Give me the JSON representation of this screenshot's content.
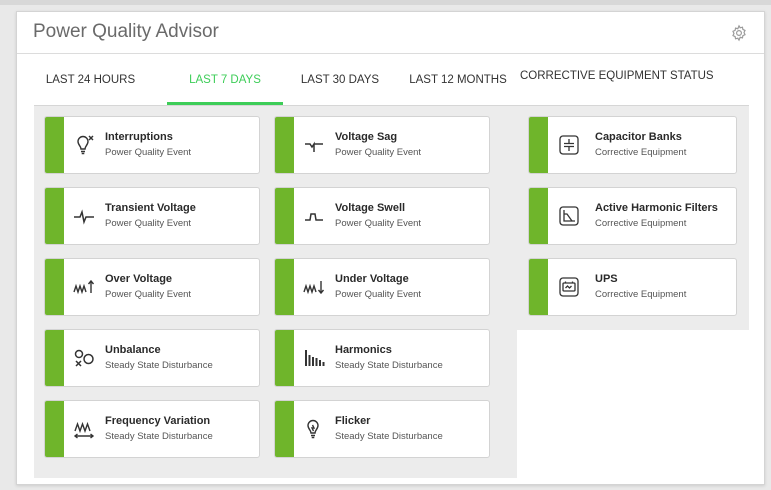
{
  "widget": {
    "title": "Power Quality Advisor"
  },
  "tabs": [
    {
      "label": "LAST 24 HOURS",
      "active": false
    },
    {
      "label": "LAST 7 DAYS",
      "active": true
    },
    {
      "label": "LAST 30 DAYS",
      "active": false
    },
    {
      "label": "LAST 12 MONTHS",
      "active": false
    }
  ],
  "events": [
    {
      "title": "Interruptions",
      "subtitle": "Power Quality Event",
      "icon": "interruption-bulb-icon"
    },
    {
      "title": "Voltage Sag",
      "subtitle": "Power Quality Event",
      "icon": "voltage-sag-icon"
    },
    {
      "title": "Transient Voltage",
      "subtitle": "Power Quality Event",
      "icon": "transient-voltage-icon"
    },
    {
      "title": "Voltage Swell",
      "subtitle": "Power Quality Event",
      "icon": "voltage-swell-icon"
    },
    {
      "title": "Over Voltage",
      "subtitle": "Power Quality Event",
      "icon": "over-voltage-icon"
    },
    {
      "title": "Under Voltage",
      "subtitle": "Power Quality Event",
      "icon": "under-voltage-icon"
    },
    {
      "title": "Unbalance",
      "subtitle": "Steady State Disturbance",
      "icon": "unbalance-icon"
    },
    {
      "title": "Harmonics",
      "subtitle": "Steady State Disturbance",
      "icon": "harmonics-icon"
    },
    {
      "title": "Frequency Variation",
      "subtitle": "Steady State Disturbance",
      "icon": "frequency-variation-icon"
    },
    {
      "title": "Flicker",
      "subtitle": "Steady State Disturbance",
      "icon": "flicker-icon"
    }
  ],
  "corrective": {
    "title": "CORRECTIVE EQUIPMENT STATUS",
    "items": [
      {
        "title": "Capacitor Banks",
        "subtitle": "Corrective Equipment",
        "icon": "capacitor-icon"
      },
      {
        "title": "Active Harmonic Filters",
        "subtitle": "Corrective Equipment",
        "icon": "harmonic-filter-icon"
      },
      {
        "title": "UPS",
        "subtitle": "Corrective Equipment",
        "icon": "ups-battery-icon"
      }
    ]
  },
  "colors": {
    "accent": "#3dcd58",
    "status_bar": "#6fb52b"
  }
}
